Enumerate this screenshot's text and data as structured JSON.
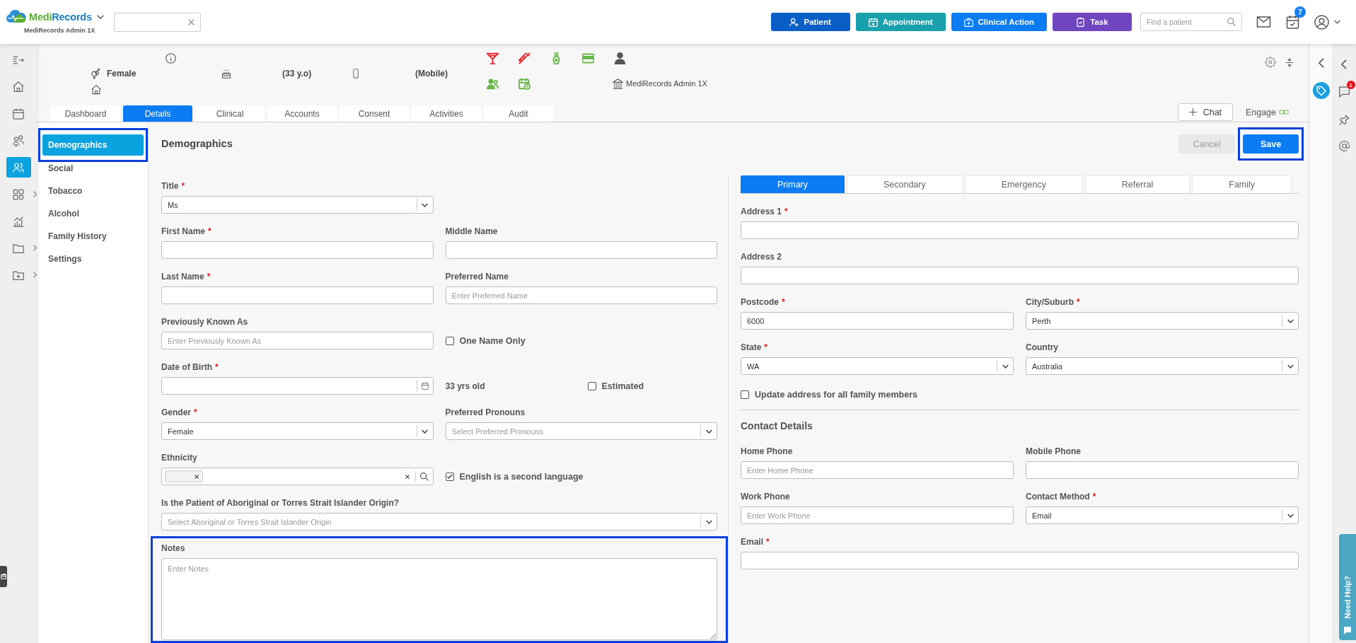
{
  "top_bar": {
    "logo": {
      "words": [
        {
          "text": "Medi",
          "color": "#5ab031"
        },
        {
          "text": "Records",
          "color": "#1f7fc0"
        }
      ],
      "subtitle": "MediRecords Admin 1X"
    },
    "actions": [
      {
        "label": "Patient",
        "color": "#0a5fc6"
      },
      {
        "label": "Appointment",
        "color": "#18a1ad"
      },
      {
        "label": "Clinical Action",
        "color": "#0b7cf3"
      },
      {
        "label": "Task",
        "color": "#7046c0"
      }
    ],
    "patient_search": {
      "placeholder": "Find a patient"
    },
    "tasks_badge": "7"
  },
  "left_rail": {
    "items": [
      {
        "selected": false,
        "submenu": false
      },
      {
        "selected": false,
        "submenu": false
      },
      {
        "selected": false,
        "submenu": false
      },
      {
        "selected": false,
        "submenu": false
      },
      {
        "selected": true,
        "submenu": false
      },
      {
        "selected": false,
        "submenu": true
      },
      {
        "selected": false,
        "submenu": false
      },
      {
        "selected": false,
        "submenu": true
      },
      {
        "selected": false,
        "submenu": true
      }
    ]
  },
  "patient_header": {
    "gender": "Female",
    "age": "(33 y.o)",
    "phone": "(Mobile)",
    "practice": "MediRecords Admin 1X",
    "flags": [
      {
        "color": "#e8262b"
      },
      {
        "color": "#e8262b"
      },
      {
        "color": "#66b947"
      },
      {
        "color": "#66b947"
      },
      {
        "color": "#555555"
      },
      {
        "color": "#66b947"
      },
      {
        "color": "#66b947"
      }
    ]
  },
  "tabs": [
    {
      "label": "Dashboard",
      "selected": false
    },
    {
      "label": "Details",
      "selected": true
    },
    {
      "label": "Clinical",
      "selected": false
    },
    {
      "label": "Accounts",
      "selected": false
    },
    {
      "label": "Consent",
      "selected": false
    },
    {
      "label": "Activities",
      "selected": false
    },
    {
      "label": "Audit",
      "selected": false
    }
  ],
  "chat": {
    "label": "Chat"
  },
  "engage": {
    "label": "Engage"
  },
  "submenu": [
    {
      "label": "Demographics",
      "selected": true,
      "highlighted": true
    },
    {
      "label": "Social",
      "selected": false,
      "highlighted": false
    },
    {
      "label": "Tobacco",
      "selected": false,
      "highlighted": false
    },
    {
      "label": "Alcohol",
      "selected": false,
      "highlighted": false
    },
    {
      "label": "Family History",
      "selected": false,
      "highlighted": false
    },
    {
      "label": "Settings",
      "selected": false,
      "highlighted": false
    }
  ],
  "form": {
    "title": "Demographics",
    "cancel": {
      "label": "Cancel",
      "disabled": true
    },
    "save": {
      "label": "Save",
      "highlighted": true
    },
    "columns": [
      {
        "blocks": [
          {
            "kind": "pair",
            "fields": [
              {
                "kind": "select",
                "label": "Title",
                "required_mark": "*",
                "value": "Ms"
              }
            ]
          },
          {
            "kind": "pair",
            "fields": [
              {
                "kind": "input",
                "label": "First Name",
                "required_mark": "*"
              },
              {
                "kind": "input",
                "label": "Middle Name"
              }
            ]
          },
          {
            "kind": "pair",
            "fields": [
              {
                "kind": "input",
                "label": "Last Name",
                "required_mark": "*"
              },
              {
                "kind": "input",
                "label": "Preferred Name",
                "placeholder": "Enter Preferred Name"
              }
            ]
          },
          {
            "kind": "pair",
            "fields": [
              {
                "kind": "input",
                "label": "Previously Known As",
                "placeholder": "Enter Previously Known As"
              },
              {
                "kind": "checkbox",
                "label": "One Name Only",
                "checked": false
              }
            ]
          },
          {
            "kind": "pair",
            "fields": [
              {
                "kind": "date",
                "label": "Date of Birth",
                "required_mark": "*"
              },
              {
                "kind": "age",
                "text": "33 yrs old",
                "checkbox": {
                  "label": "Estimated",
                  "checked": false
                }
              }
            ]
          },
          {
            "kind": "pair",
            "fields": [
              {
                "kind": "select",
                "label": "Gender",
                "required_mark": "*",
                "value": "Female"
              },
              {
                "kind": "select",
                "label": "Preferred Pronouns",
                "placeholder": "Select Preferred Pronouns"
              }
            ]
          },
          {
            "kind": "pair",
            "fields": [
              {
                "kind": "multiselect",
                "label": "Ethnicity",
                "selected_chip": true
              },
              {
                "kind": "checkbox",
                "label": "English is a second language",
                "checked": true
              }
            ]
          },
          {
            "kind": "wide",
            "fields": [
              {
                "kind": "select",
                "label": "Is the Patient of Aboriginal or Torres Strait Islander Origin?",
                "placeholder": "Select Aboriginal or Torres Strait Islander Origin"
              }
            ]
          },
          {
            "kind": "notes",
            "label": "Notes",
            "placeholder": "Enter Notes",
            "highlighted": true
          }
        ]
      },
      {
        "blocks": [
          {
            "kind": "tabs",
            "items": [
              {
                "label": "Primary",
                "selected": true
              },
              {
                "label": "Secondary",
                "selected": false
              },
              {
                "label": "Emergency",
                "selected": false
              },
              {
                "label": "Referral",
                "selected": false
              },
              {
                "label": "Family",
                "selected": false
              }
            ]
          },
          {
            "kind": "wide",
            "fields": [
              {
                "kind": "input",
                "label": "Address 1",
                "required_mark": "*"
              }
            ]
          },
          {
            "kind": "wide",
            "fields": [
              {
                "kind": "input",
                "label": "Address 2"
              }
            ]
          },
          {
            "kind": "pair",
            "fields": [
              {
                "kind": "input",
                "label": "Postcode",
                "required_mark": "*",
                "value": "6000"
              },
              {
                "kind": "select",
                "label": "City/Suburb",
                "required_mark": "*",
                "value": "Perth"
              }
            ]
          },
          {
            "kind": "pair",
            "fields": [
              {
                "kind": "select",
                "label": "State",
                "required_mark": "*",
                "value": "WA"
              },
              {
                "kind": "select",
                "label": "Country",
                "value": "Australia"
              }
            ]
          },
          {
            "kind": "checkline",
            "fields": [
              {
                "kind": "checkbox",
                "label": "Update address for all family members",
                "checked": false
              }
            ]
          },
          {
            "kind": "section",
            "title": "Contact Details"
          },
          {
            "kind": "pair",
            "fields": [
              {
                "kind": "input",
                "label": "Home Phone",
                "placeholder": "Enter Home Phone"
              },
              {
                "kind": "input",
                "label": "Mobile Phone"
              }
            ]
          },
          {
            "kind": "pair",
            "fields": [
              {
                "kind": "input",
                "label": "Work Phone",
                "placeholder": "Enter Work Phone"
              },
              {
                "kind": "select",
                "label": "Contact Method",
                "required_mark": "*",
                "value": "Email"
              }
            ]
          },
          {
            "kind": "wide",
            "fields": [
              {
                "kind": "input",
                "label": "Email",
                "required_mark": "*"
              }
            ]
          }
        ]
      }
    ]
  },
  "right_panel": {
    "chat_badge": "1",
    "help": {
      "label": "Need Help?"
    }
  }
}
